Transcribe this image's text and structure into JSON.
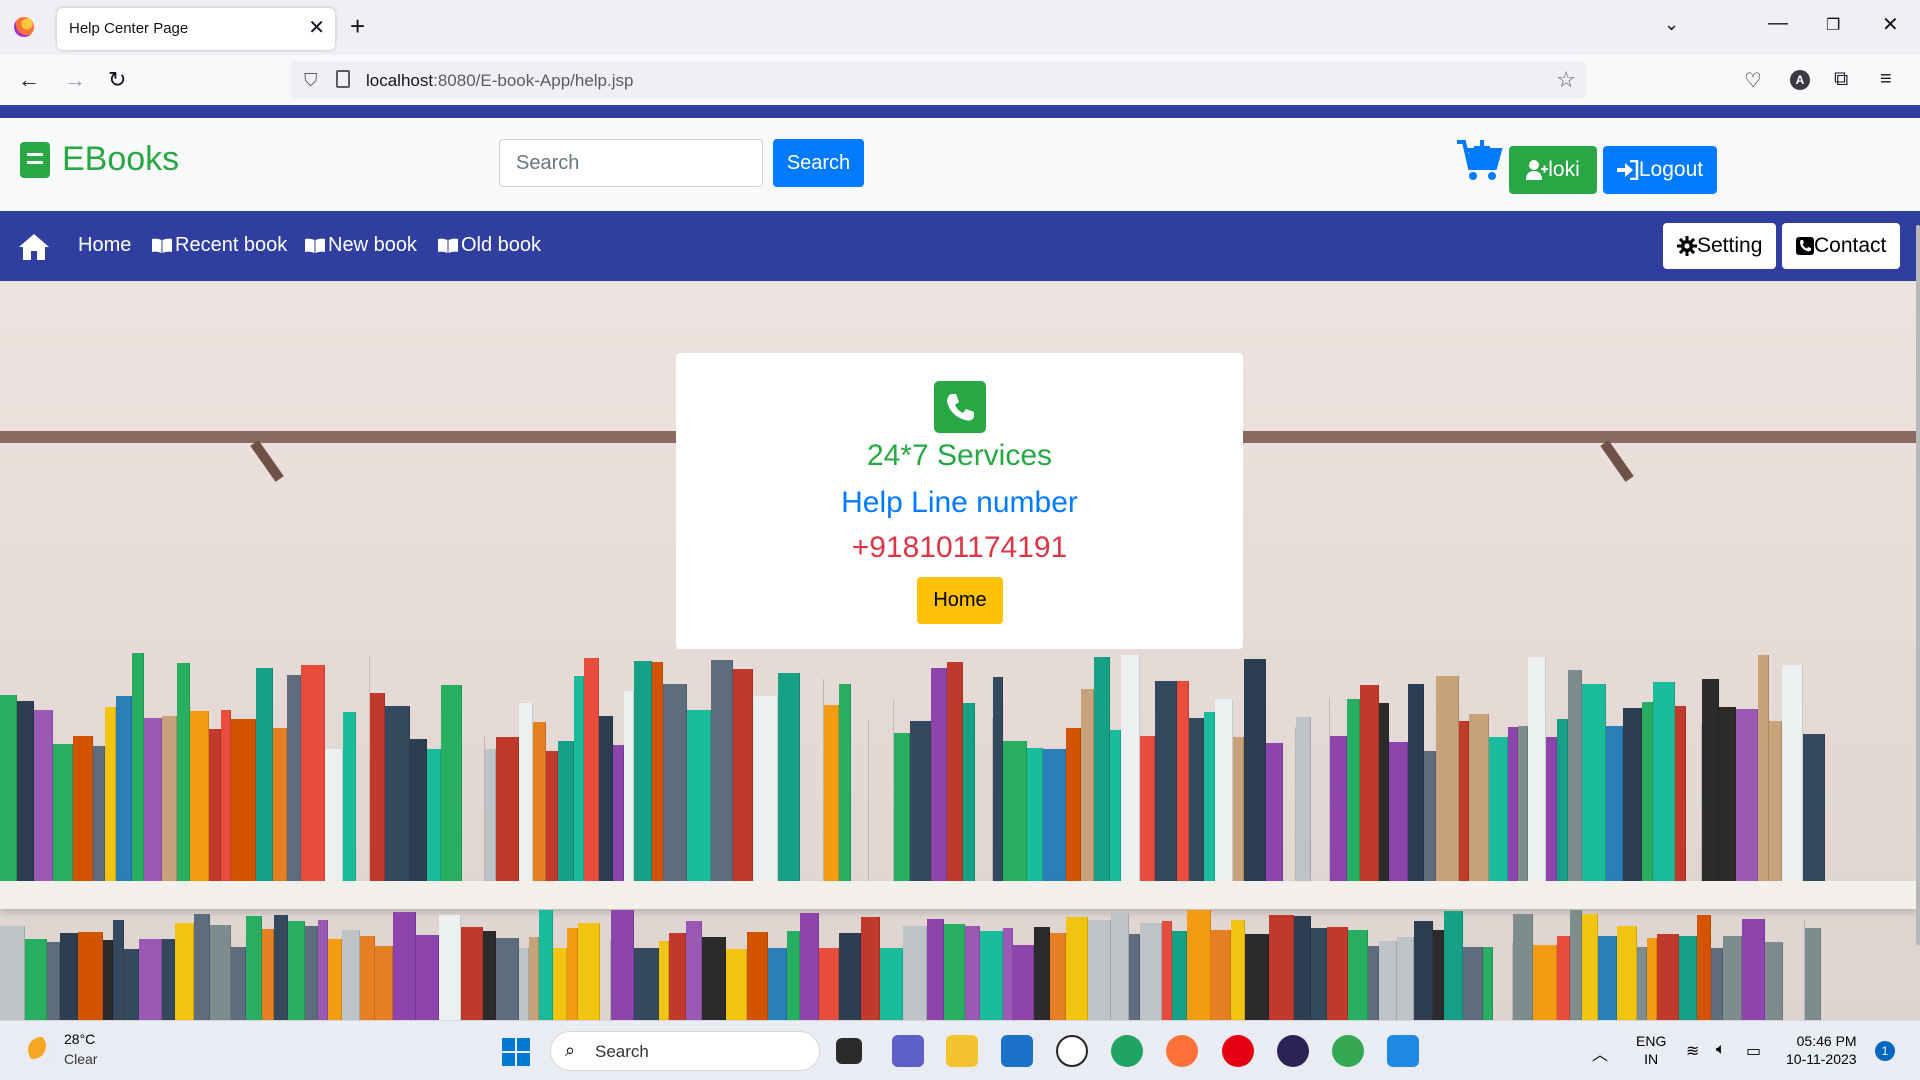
{
  "browser": {
    "tab_title": "Help Center Page",
    "url_host": "localhost",
    "url_rest": ":8080/E-book-App/help.jsp",
    "profile_initial": "A"
  },
  "header": {
    "brand": "EBooks",
    "search_placeholder": "Search",
    "search_button": "Search",
    "user_label": "loki",
    "logout_label": "Logout"
  },
  "nav": {
    "items": [
      {
        "label": "Home"
      },
      {
        "label": "Recent book"
      },
      {
        "label": "New book"
      },
      {
        "label": "Old book"
      }
    ],
    "setting_label": "Setting",
    "contact_label": "Contact"
  },
  "card": {
    "services": "24*7 Services",
    "helpline_label": "Help Line number",
    "phone": "+918101174191",
    "home_button": "Home"
  },
  "taskbar": {
    "temperature": "28°C",
    "condition": "Clear",
    "search_label": "Search",
    "lang_line1": "ENG",
    "lang_line2": "IN",
    "time": "05:46 PM",
    "date": "10-11-2023",
    "notification_count": "1"
  },
  "colors": {
    "primary": "#007bff",
    "success": "#28a745",
    "danger": "#dc3545",
    "warning": "#ffc107",
    "nav_bg": "#303f9f"
  }
}
